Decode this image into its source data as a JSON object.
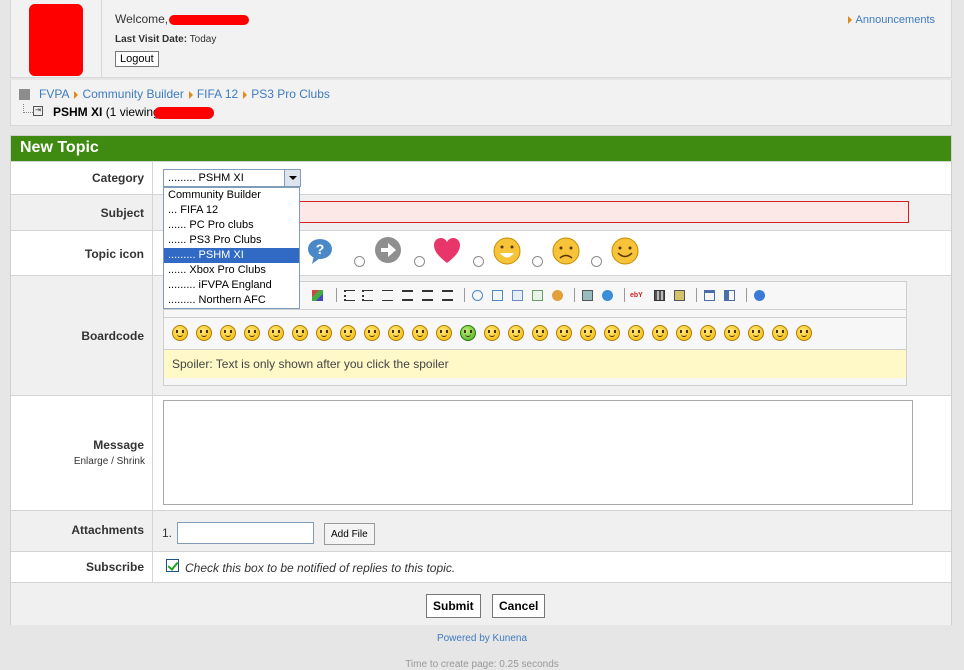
{
  "user": {
    "welcome_prefix": "Welcome,",
    "last_visit_label": "Last Visit Date:",
    "last_visit_value": "Today",
    "logout_label": "Logout",
    "announcements_label": "Announcements"
  },
  "breadcrumb": {
    "items": [
      "FVPA",
      "Community Builder",
      "FIFA 12",
      "PS3 Pro Clubs"
    ],
    "current_title": "PSHM XI",
    "viewing_text": "(1 viewing"
  },
  "form": {
    "title": "New Topic",
    "category": {
      "label": "Category",
      "selected": "......... PSHM XI",
      "options": [
        "Community Builder",
        "... FIFA 12",
        "...... PC Pro clubs",
        "...... PS3 Pro Clubs",
        "......... PSHM XI",
        "...... Xbox Pro Clubs",
        "......... iFVPA England",
        "......... Northern AFC"
      ]
    },
    "subject_label": "Subject",
    "topic_icon_label": "Topic icon",
    "topic_icons": [
      "speech-bubble-icon",
      "arrow-right-icon",
      "heart-icon",
      "laughing-face-icon",
      "sad-face-icon",
      "smiley-face-icon"
    ],
    "boardcode_label": "Boardcode",
    "spoiler_text": "Spoiler: Text is only shown after you click the spoiler",
    "message_label": "Message",
    "enlarge_label": "Enlarge",
    "shrink_label": "Shrink",
    "attachments_label": "Attachments",
    "attachment_number": "1.",
    "add_file_label": "Add File",
    "subscribe_label": "Subscribe",
    "subscribe_text": "Check this box to be notified of replies to this topic.",
    "subscribe_checked": true,
    "submit_label": "Submit",
    "cancel_label": "Cancel"
  },
  "footer": {
    "powered_by": "Powered by Kunena",
    "time_text": "Time to create page: 0.25 seconds"
  },
  "colors": {
    "title_bar": "#3f8a11",
    "link": "#3e7bbf",
    "redaction": "#ff0000",
    "subject_error_border": "#d32020"
  }
}
